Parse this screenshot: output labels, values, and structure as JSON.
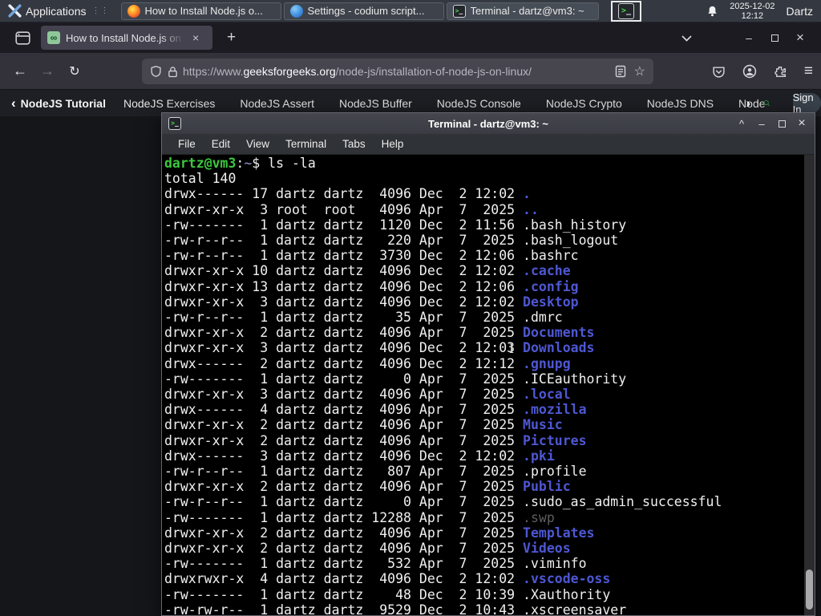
{
  "taskbar": {
    "applications_label": "Applications",
    "windows": [
      {
        "title": "How to Install Node.js o...",
        "icon": "firefox-icon"
      },
      {
        "title": "Settings - codium script...",
        "icon": "codium-icon"
      },
      {
        "title": "Terminal - dartz@vm3: ~",
        "icon": "terminal-icon"
      }
    ],
    "clock_date": "2025-12-02",
    "clock_time": "12:12",
    "user": "Dartz"
  },
  "browser": {
    "tab": {
      "title": "How to Install Node.js on",
      "favicon_glyph": "∞"
    },
    "new_tab_label": "+",
    "toolbar": {
      "back_glyph": "←",
      "forward_glyph": "→",
      "reload_glyph": "↻",
      "url_protocol": "https://www.",
      "url_domain": "geeksforgeeks.org",
      "url_path": "/node-js/installation-of-node-js-on-linux/",
      "star_glyph": "☆",
      "menu_glyph": "≡"
    },
    "page_nav": {
      "back_chevron": "‹",
      "active_item": "NodeJS Tutorial",
      "items": [
        "NodeJS Exercises",
        "NodeJS Assert",
        "NodeJS Buffer",
        "NodeJS Console",
        "NodeJS Crypto",
        "NodeJS DNS",
        "Node"
      ],
      "forward_chevron": "›",
      "sign_in_label": "Sign In"
    }
  },
  "terminal": {
    "title": "Terminal - dartz@vm3: ~",
    "menu_items": [
      "File",
      "Edit",
      "View",
      "Terminal",
      "Tabs",
      "Help"
    ],
    "controls": {
      "shade": "^",
      "minimize": "–",
      "close": "×"
    },
    "prompt": {
      "user_host": "dartz@vm3",
      "separator": ":",
      "cwd": "~",
      "symbol": "$ ",
      "command": "ls -la"
    },
    "total_line": "total 140",
    "ls_entries": [
      {
        "p": "drwx------",
        "n": "17",
        "o": "dartz",
        "g": "dartz",
        "s": "4096",
        "m": "Dec",
        "d": "2",
        "t": "12:02",
        "f": ".",
        "c": "dir"
      },
      {
        "p": "drwxr-xr-x",
        "n": "3",
        "o": "root",
        "g": "root",
        "s": "4096",
        "m": "Apr",
        "d": "7",
        "t": "2025",
        "f": "..",
        "c": "dir"
      },
      {
        "p": "-rw-------",
        "n": "1",
        "o": "dartz",
        "g": "dartz",
        "s": "1120",
        "m": "Dec",
        "d": "2",
        "t": "11:56",
        "f": ".bash_history",
        "c": "file"
      },
      {
        "p": "-rw-r--r--",
        "n": "1",
        "o": "dartz",
        "g": "dartz",
        "s": "220",
        "m": "Apr",
        "d": "7",
        "t": "2025",
        "f": ".bash_logout",
        "c": "file"
      },
      {
        "p": "-rw-r--r--",
        "n": "1",
        "o": "dartz",
        "g": "dartz",
        "s": "3730",
        "m": "Dec",
        "d": "2",
        "t": "12:06",
        "f": ".bashrc",
        "c": "file"
      },
      {
        "p": "drwxr-xr-x",
        "n": "10",
        "o": "dartz",
        "g": "dartz",
        "s": "4096",
        "m": "Dec",
        "d": "2",
        "t": "12:02",
        "f": ".cache",
        "c": "dir"
      },
      {
        "p": "drwxr-xr-x",
        "n": "13",
        "o": "dartz",
        "g": "dartz",
        "s": "4096",
        "m": "Dec",
        "d": "2",
        "t": "12:06",
        "f": ".config",
        "c": "dir"
      },
      {
        "p": "drwxr-xr-x",
        "n": "3",
        "o": "dartz",
        "g": "dartz",
        "s": "4096",
        "m": "Dec",
        "d": "2",
        "t": "12:02",
        "f": "Desktop",
        "c": "dir"
      },
      {
        "p": "-rw-r--r--",
        "n": "1",
        "o": "dartz",
        "g": "dartz",
        "s": "35",
        "m": "Apr",
        "d": "7",
        "t": "2025",
        "f": ".dmrc",
        "c": "file"
      },
      {
        "p": "drwxr-xr-x",
        "n": "2",
        "o": "dartz",
        "g": "dartz",
        "s": "4096",
        "m": "Apr",
        "d": "7",
        "t": "2025",
        "f": "Documents",
        "c": "dir"
      },
      {
        "p": "drwxr-xr-x",
        "n": "3",
        "o": "dartz",
        "g": "dartz",
        "s": "4096",
        "m": "Dec",
        "d": "2",
        "t": "12:03",
        "f": "Downloads",
        "c": "dir"
      },
      {
        "p": "drwx------",
        "n": "2",
        "o": "dartz",
        "g": "dartz",
        "s": "4096",
        "m": "Dec",
        "d": "2",
        "t": "12:12",
        "f": ".gnupg",
        "c": "dir"
      },
      {
        "p": "-rw-------",
        "n": "1",
        "o": "dartz",
        "g": "dartz",
        "s": "0",
        "m": "Apr",
        "d": "7",
        "t": "2025",
        "f": ".ICEauthority",
        "c": "file"
      },
      {
        "p": "drwxr-xr-x",
        "n": "3",
        "o": "dartz",
        "g": "dartz",
        "s": "4096",
        "m": "Apr",
        "d": "7",
        "t": "2025",
        "f": ".local",
        "c": "dir"
      },
      {
        "p": "drwx------",
        "n": "4",
        "o": "dartz",
        "g": "dartz",
        "s": "4096",
        "m": "Apr",
        "d": "7",
        "t": "2025",
        "f": ".mozilla",
        "c": "dir"
      },
      {
        "p": "drwxr-xr-x",
        "n": "2",
        "o": "dartz",
        "g": "dartz",
        "s": "4096",
        "m": "Apr",
        "d": "7",
        "t": "2025",
        "f": "Music",
        "c": "dir"
      },
      {
        "p": "drwxr-xr-x",
        "n": "2",
        "o": "dartz",
        "g": "dartz",
        "s": "4096",
        "m": "Apr",
        "d": "7",
        "t": "2025",
        "f": "Pictures",
        "c": "dir"
      },
      {
        "p": "drwx------",
        "n": "3",
        "o": "dartz",
        "g": "dartz",
        "s": "4096",
        "m": "Dec",
        "d": "2",
        "t": "12:02",
        "f": ".pki",
        "c": "dir"
      },
      {
        "p": "-rw-r--r--",
        "n": "1",
        "o": "dartz",
        "g": "dartz",
        "s": "807",
        "m": "Apr",
        "d": "7",
        "t": "2025",
        "f": ".profile",
        "c": "file"
      },
      {
        "p": "drwxr-xr-x",
        "n": "2",
        "o": "dartz",
        "g": "dartz",
        "s": "4096",
        "m": "Apr",
        "d": "7",
        "t": "2025",
        "f": "Public",
        "c": "dir"
      },
      {
        "p": "-rw-r--r--",
        "n": "1",
        "o": "dartz",
        "g": "dartz",
        "s": "0",
        "m": "Apr",
        "d": "7",
        "t": "2025",
        "f": ".sudo_as_admin_successful",
        "c": "file"
      },
      {
        "p": "-rw-------",
        "n": "1",
        "o": "dartz",
        "g": "dartz",
        "s": "12288",
        "m": "Apr",
        "d": "7",
        "t": "2025",
        "f": ".swp",
        "c": "dim"
      },
      {
        "p": "drwxr-xr-x",
        "n": "2",
        "o": "dartz",
        "g": "dartz",
        "s": "4096",
        "m": "Apr",
        "d": "7",
        "t": "2025",
        "f": "Templates",
        "c": "dir"
      },
      {
        "p": "drwxr-xr-x",
        "n": "2",
        "o": "dartz",
        "g": "dartz",
        "s": "4096",
        "m": "Apr",
        "d": "7",
        "t": "2025",
        "f": "Videos",
        "c": "dir"
      },
      {
        "p": "-rw-------",
        "n": "1",
        "o": "dartz",
        "g": "dartz",
        "s": "532",
        "m": "Apr",
        "d": "7",
        "t": "2025",
        "f": ".viminfo",
        "c": "file"
      },
      {
        "p": "drwxrwxr-x",
        "n": "4",
        "o": "dartz",
        "g": "dartz",
        "s": "4096",
        "m": "Dec",
        "d": "2",
        "t": "12:02",
        "f": ".vscode-oss",
        "c": "dir"
      },
      {
        "p": "-rw-------",
        "n": "1",
        "o": "dartz",
        "g": "dartz",
        "s": "48",
        "m": "Dec",
        "d": "2",
        "t": "10:39",
        "f": ".Xauthority",
        "c": "file"
      },
      {
        "p": "-rw-rw-r--",
        "n": "1",
        "o": "dartz",
        "g": "dartz",
        "s": "9529",
        "m": "Dec",
        "d": "2",
        "t": "10:43",
        "f": ".xscreensaver",
        "c": "file"
      }
    ]
  },
  "colors": {
    "gfg_green": "#2f8d46",
    "terminal_prompt_green": "#3ec73e",
    "directory_blue": "#4e57d2",
    "dim_gray": "#5e5e5e",
    "terminal_background": "#000000"
  }
}
